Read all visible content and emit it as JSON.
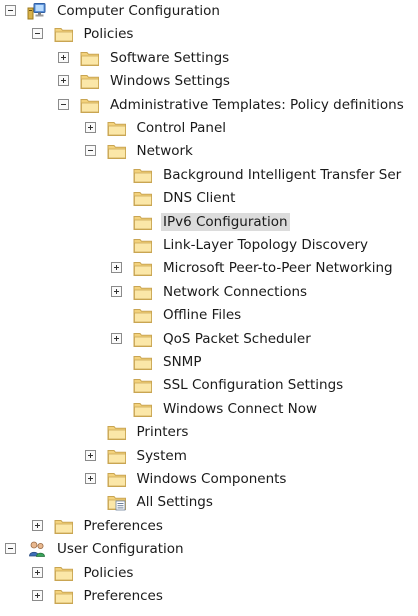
{
  "tree": [
    {
      "label": "Computer Configuration",
      "level": 0,
      "expander": "expanded",
      "icon": "computer-icon"
    },
    {
      "label": "Policies",
      "level": 1,
      "expander": "expanded",
      "icon": "folder-icon"
    },
    {
      "label": "Software Settings",
      "level": 2,
      "expander": "collapsed",
      "icon": "folder-icon"
    },
    {
      "label": "Windows Settings",
      "level": 2,
      "expander": "collapsed",
      "icon": "folder-icon"
    },
    {
      "label": "Administrative Templates: Policy definitions",
      "level": 2,
      "expander": "expanded",
      "icon": "folder-icon"
    },
    {
      "label": "Control Panel",
      "level": 3,
      "expander": "collapsed",
      "icon": "folder-icon"
    },
    {
      "label": "Network",
      "level": 3,
      "expander": "expanded",
      "icon": "folder-icon"
    },
    {
      "label": "Background Intelligent Transfer Ser",
      "level": 4,
      "expander": "none",
      "icon": "folder-icon"
    },
    {
      "label": "DNS Client",
      "level": 4,
      "expander": "none",
      "icon": "folder-icon"
    },
    {
      "label": "IPv6 Configuration",
      "level": 4,
      "expander": "none",
      "icon": "folder-icon",
      "selected": true
    },
    {
      "label": "Link-Layer Topology Discovery",
      "level": 4,
      "expander": "none",
      "icon": "folder-icon"
    },
    {
      "label": "Microsoft Peer-to-Peer Networking",
      "level": 4,
      "expander": "collapsed",
      "icon": "folder-icon"
    },
    {
      "label": "Network Connections",
      "level": 4,
      "expander": "collapsed",
      "icon": "folder-icon"
    },
    {
      "label": "Offline Files",
      "level": 4,
      "expander": "none",
      "icon": "folder-icon"
    },
    {
      "label": "QoS Packet Scheduler",
      "level": 4,
      "expander": "collapsed",
      "icon": "folder-icon"
    },
    {
      "label": "SNMP",
      "level": 4,
      "expander": "none",
      "icon": "folder-icon"
    },
    {
      "label": "SSL Configuration Settings",
      "level": 4,
      "expander": "none",
      "icon": "folder-icon"
    },
    {
      "label": "Windows Connect Now",
      "level": 4,
      "expander": "none",
      "icon": "folder-icon"
    },
    {
      "label": "Printers",
      "level": 3,
      "expander": "none",
      "icon": "folder-icon"
    },
    {
      "label": "System",
      "level": 3,
      "expander": "collapsed",
      "icon": "folder-icon"
    },
    {
      "label": "Windows Components",
      "level": 3,
      "expander": "collapsed",
      "icon": "folder-icon"
    },
    {
      "label": "All Settings",
      "level": 3,
      "expander": "none",
      "icon": "all-settings-icon"
    },
    {
      "label": "Preferences",
      "level": 1,
      "expander": "collapsed",
      "icon": "folder-icon"
    },
    {
      "label": "User Configuration",
      "level": 0,
      "expander": "expanded",
      "icon": "user-icon"
    },
    {
      "label": "Policies",
      "level": 1,
      "expander": "collapsed",
      "icon": "folder-icon"
    },
    {
      "label": "Preferences",
      "level": 1,
      "expander": "collapsed",
      "icon": "folder-icon"
    }
  ],
  "colors": {
    "selection": "#dcdcdc",
    "folder_body": "#f3d27d",
    "folder_front": "#fbe7a8",
    "folder_edge": "#c9a552"
  }
}
